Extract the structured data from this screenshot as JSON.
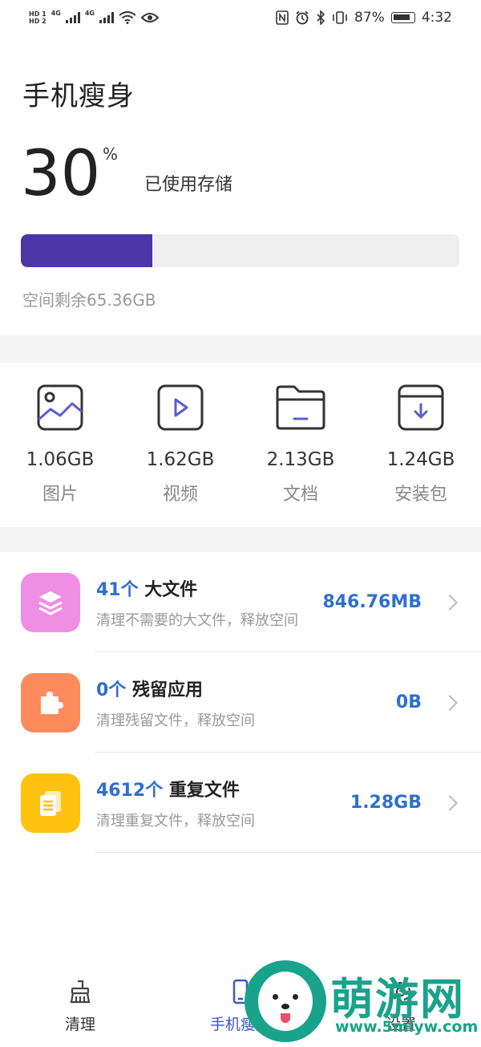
{
  "status_bar": {
    "hd1": "HD 1",
    "hd2": "HD 2",
    "net1": "4G",
    "net2": "4G",
    "battery_pct": "87%",
    "time": "4:32"
  },
  "header": {
    "title": "手机瘦身",
    "used_percent_value": "30",
    "used_percent_sign": "%",
    "used_label": "已使用存储",
    "used_fraction": 0.3,
    "remaining": "空间剩余65.36GB"
  },
  "categories": [
    {
      "icon": "image-icon",
      "size": "1.06GB",
      "label": "图片"
    },
    {
      "icon": "video-icon",
      "size": "1.62GB",
      "label": "视频"
    },
    {
      "icon": "folder-icon",
      "size": "2.13GB",
      "label": "文档"
    },
    {
      "icon": "download-package-icon",
      "size": "1.24GB",
      "label": "安装包"
    }
  ],
  "items": [
    {
      "icon": "layers-icon",
      "color": "#f08ee6",
      "count": "41个",
      "name": " 大文件",
      "desc": "清理不需要的大文件，释放空间",
      "size": "846.76MB"
    },
    {
      "icon": "puzzle-icon",
      "color": "#ff8a5c",
      "count": "0个",
      "name": " 残留应用",
      "desc": "清理残留文件，释放空间",
      "size": "0B"
    },
    {
      "icon": "documents-icon",
      "color": "#ffc20e",
      "count": "4612个",
      "name": " 重复文件",
      "desc": "清理重复文件，释放空间",
      "size": "1.28GB"
    }
  ],
  "nav": [
    {
      "icon": "broom-icon",
      "label": "清理",
      "active": false
    },
    {
      "icon": "phone-icon",
      "label": "手机瘦身",
      "active": true
    },
    {
      "icon": "settings-icon",
      "label": "设置",
      "active": false
    }
  ],
  "watermark": {
    "brand": "萌游网",
    "url": "www.5mlyw.com"
  },
  "colors": {
    "accent": "#4a36a5",
    "link_blue": "#2f6fd1",
    "nav_active": "#3b57c4",
    "watermark": "#18a38a"
  }
}
